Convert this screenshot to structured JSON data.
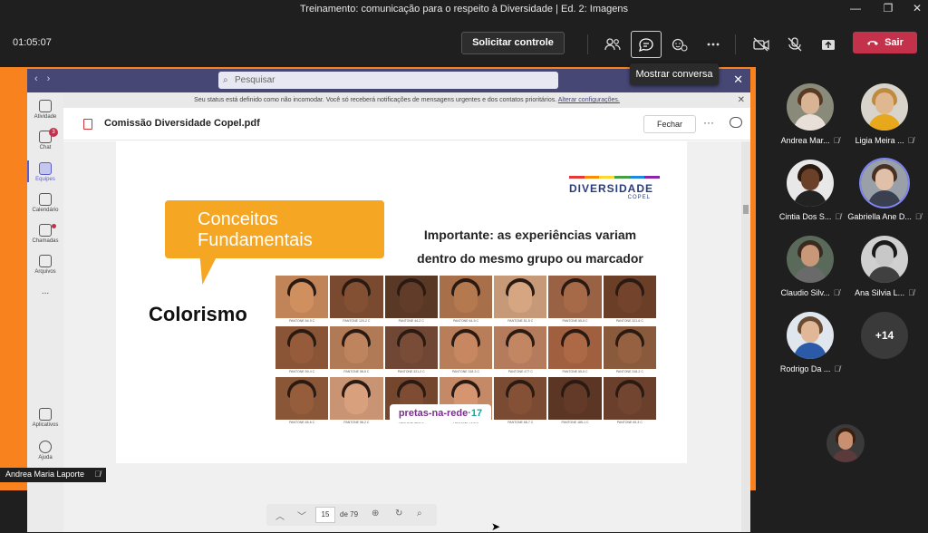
{
  "window": {
    "title": "Treinamento: comunicação para o respeito à Diversidade | Ed. 2: Imagens",
    "controls": [
      "minimize",
      "maximize",
      "close"
    ]
  },
  "meeting_toolbar": {
    "timer": "01:05:07",
    "request_control_label": "Solicitar controle",
    "leave_label": "Sair",
    "tooltip": "Mostrar conversa",
    "icons": [
      "people-icon",
      "chat-icon",
      "reactions-icon",
      "more-icon",
      "camera-off-icon",
      "mic-off-icon",
      "share-icon"
    ]
  },
  "shared_screen": {
    "teams_search_placeholder": "Pesquisar",
    "banner_text": "Seu status está definido como não incomodar. Você só receberá notificações de mensagens urgentes e dos contatos prioritários.",
    "banner_link": "Alterar configurações.",
    "document_name": "Comissão Diversidade Copel.pdf",
    "close_button_label": "Fechar",
    "rail": [
      {
        "label": "Atividade"
      },
      {
        "label": "Chat",
        "badge": "3"
      },
      {
        "label": "Equipes",
        "active": true
      },
      {
        "label": "Calendário"
      },
      {
        "label": "Chamadas"
      },
      {
        "label": "Arquivos"
      },
      {
        "label": "..."
      },
      {
        "label": "Aplicativos"
      },
      {
        "label": "Ajuda"
      }
    ],
    "slide": {
      "bubble_line1": "Conceitos",
      "bubble_line2": "Fundamentais",
      "logo_big": "DIVERSIDADE",
      "logo_small": "COPEL",
      "important_line1": "Importante: as experiências variam",
      "important_line2": "dentro do mesmo grupo ou marcador",
      "heading": "Colorismo",
      "watermark_part1": "pretas-na-rede",
      "watermark_part2": "·17",
      "pantone_labels": [
        "PANTONE 54-9 C",
        "PANTONE 120-2 C",
        "PANTONE 44-2 C",
        "PANTONE 64-5 C",
        "PANTONE 51-5 C",
        "PANTONE 65-5 C",
        "PANTONE 321-6 C",
        "PANTONE 59-4 C",
        "PANTONE 58-5 C",
        "PANTONE 321-2 C",
        "PANTONE 318-3 C",
        "PANTONE 477 C",
        "PANTONE 65-5 C",
        "PANTONE 318-2 C",
        "PANTONE 65-6 C",
        "PANTONE 58-2 C",
        "PANTONE 66-5 C",
        "PANTONE 71-6 C",
        "PANTONE 68-7 C",
        "PANTONE 185-1 C",
        "PANTONE 69-3 C"
      ],
      "swatch_colors": [
        "#c08458",
        "#7a4a30",
        "#5a3826",
        "#a8704a",
        "#c69a78",
        "#9a6244",
        "#6b3e28",
        "#8a5436",
        "#b07a56",
        "#704634",
        "#b87e5a",
        "#b47c5c",
        "#a06040",
        "#8a5a3c",
        "#8a5638",
        "#c89474",
        "#74462e",
        "#c48a68",
        "#7a4a32",
        "#5c3624",
        "#6a402c"
      ]
    },
    "page_number": "15",
    "page_total": "de 79",
    "presenter_name": "Andrea Maria Laporte"
  },
  "participants": [
    {
      "name": "Andrea Mar...",
      "bg": "#8a8a7a",
      "skin": "#d8b494",
      "hair": "#5a3a22",
      "shirt": "#e8e0d8"
    },
    {
      "name": "Ligia Meira ...",
      "bg": "#d8d4cc",
      "skin": "#e0b890",
      "hair": "#c08a40",
      "shirt": "#e8a81c"
    },
    {
      "name": "Cintia Dos S...",
      "bg": "#e8e8e8",
      "skin": "#6a4028",
      "hair": "#2a1a10",
      "shirt": "#222222"
    },
    {
      "name": "Gabriella Ane D...",
      "bg": "#9aa0a8",
      "skin": "#e0c0a8",
      "hair": "#4a3020",
      "shirt": "#3a4050",
      "speaking": true
    },
    {
      "name": "Claudio Silv...",
      "bg": "#5a6a5a",
      "skin": "#c89878",
      "hair": "#3a2a20",
      "shirt": "#6a6a6a"
    },
    {
      "name": "Ana Silvia L...",
      "bg": "#d0d0d0",
      "skin": "#c8c8c8",
      "hair": "#1a1a1a",
      "shirt": "#404040"
    },
    {
      "name": "Rodrigo Da ...",
      "bg": "#dfe6ee",
      "skin": "#e0b898",
      "hair": "#6a4a30",
      "shirt": "#2a5aa8"
    }
  ],
  "more_participants": "+14",
  "self_view": {
    "bg": "#3a3a3a",
    "skin": "#c89070",
    "hair": "#3a2010"
  }
}
